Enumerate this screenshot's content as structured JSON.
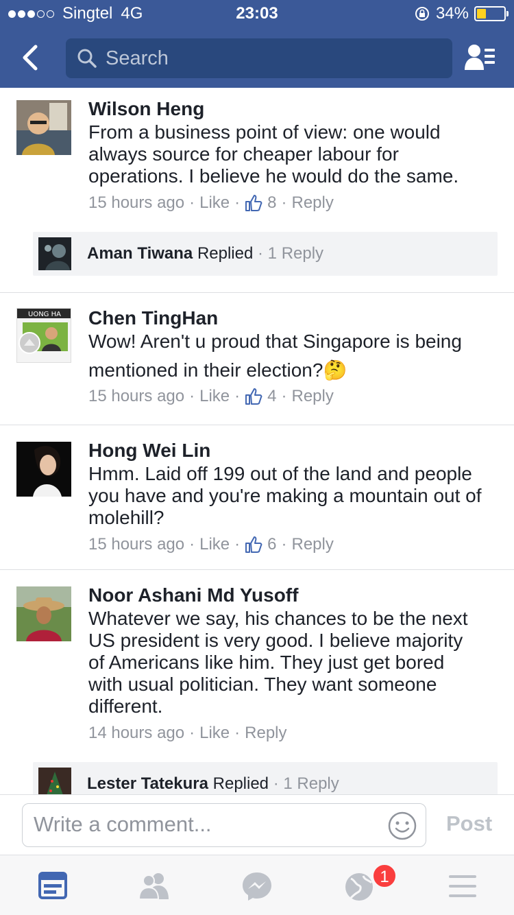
{
  "status_bar": {
    "carrier": "Singtel",
    "network": "4G",
    "time": "23:03",
    "battery": "34%",
    "battery_level": 0.34,
    "signal_bars_filled": 3,
    "signal_bars_total": 5
  },
  "nav": {
    "search_placeholder": "Search",
    "icons": [
      "back-chevron-icon",
      "search-icon",
      "friends-list-icon"
    ]
  },
  "comments": [
    {
      "name": "Wilson Heng",
      "lines": [
        "From a business point of view: one would",
        "always source for cheaper labour for",
        "operations. I believe he would do the same."
      ],
      "time": "15 hours ago",
      "like": "Like",
      "likes": "8",
      "reply": "Reply",
      "replies_preview": {
        "name": "Aman Tiwana",
        "replied": "Replied",
        "count": "1 Reply"
      }
    },
    {
      "name": "Chen TingHan",
      "lines": [
        "Wow! Aren't u proud that Singapore is being",
        "mentioned in their election?🤔"
      ],
      "time": "15 hours ago",
      "like": "Like",
      "likes": "4",
      "reply": "Reply"
    },
    {
      "name": "Hong Wei Lin",
      "lines": [
        "Hmm. Laid off 199 out of the land and people",
        "you have and you're making a mountain out of",
        "molehill?"
      ],
      "time": "15 hours ago",
      "like": "Like",
      "likes": "6",
      "reply": "Reply"
    },
    {
      "name": "Noor Ashani Md Yusoff",
      "lines": [
        "Whatever we say, his chances to be the next",
        "US president is very good. I believe majority",
        "of Americans like him. They just get bored",
        "with usual politician. They want someone",
        "different."
      ],
      "time": "14 hours ago",
      "like": "Like",
      "reply": "Reply",
      "replies_preview": {
        "name": "Lester Tatekura",
        "replied": "Replied",
        "count": "1 Reply"
      }
    }
  ],
  "composer": {
    "placeholder": "Write a comment...",
    "post_label": "Post"
  },
  "tabbar": {
    "tabs": [
      "news-feed-icon",
      "friend-requests-icon",
      "messenger-icon",
      "notifications-globe-icon",
      "menu-icon"
    ],
    "notifications_badge": "1",
    "active_color": "#4267b2",
    "inactive_color": "#bec2c9"
  },
  "colors": {
    "brand": "#3b5998",
    "search_bg": "#29487d",
    "meta_text": "#90949c"
  }
}
